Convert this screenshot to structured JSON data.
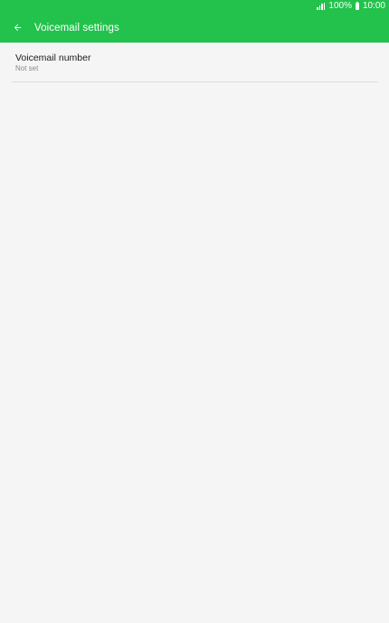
{
  "status_bar": {
    "battery_text": "100%",
    "time": "10:00",
    "signal_icon": "signal-icon",
    "battery_icon": "battery-icon"
  },
  "app_bar": {
    "title": "Voicemail settings",
    "back_icon": "arrow-back-icon",
    "color": "#22c24c"
  },
  "settings": {
    "items": [
      {
        "title": "Voicemail number",
        "subtitle": "Not set"
      }
    ]
  }
}
